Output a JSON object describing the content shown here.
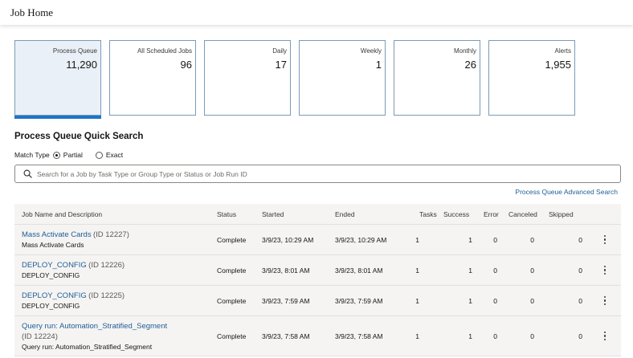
{
  "page": {
    "title": "Job Home"
  },
  "tiles": [
    {
      "label": "Process Queue",
      "value": "11,290",
      "selected": true
    },
    {
      "label": "All Scheduled Jobs",
      "value": "96",
      "selected": false
    },
    {
      "label": "Daily",
      "value": "17",
      "selected": false
    },
    {
      "label": "Weekly",
      "value": "1",
      "selected": false
    },
    {
      "label": "Monthly",
      "value": "26",
      "selected": false
    },
    {
      "label": "Alerts",
      "value": "1,955",
      "selected": false
    }
  ],
  "quick_search": {
    "title": "Process Queue Quick Search",
    "match_type_label": "Match Type",
    "options": [
      "Partial",
      "Exact"
    ],
    "selected_option": "Partial",
    "search_placeholder": "Search for a Job by Task Type or Group Type or Status or Job Run ID",
    "search_value": "",
    "advanced_link": "Process Queue Advanced Search"
  },
  "table": {
    "columns": [
      "Job Name and Description",
      "Status",
      "Started",
      "Ended",
      "Tasks",
      "Success",
      "Error",
      "Canceled",
      "Skipped"
    ],
    "rows": [
      {
        "name": "Mass Activate Cards",
        "id": "(ID 12227)",
        "desc": "Mass Activate Cards",
        "status": "Complete",
        "started": "3/9/23, 10:29 AM",
        "ended": "3/9/23, 10:29 AM",
        "tasks": "1",
        "success": "1",
        "error": "0",
        "canceled": "0",
        "skipped": "0"
      },
      {
        "name": "DEPLOY_CONFIG",
        "id": "(ID 12226)",
        "desc": "DEPLOY_CONFIG",
        "status": "Complete",
        "started": "3/9/23, 8:01 AM",
        "ended": "3/9/23, 8:01 AM",
        "tasks": "1",
        "success": "1",
        "error": "0",
        "canceled": "0",
        "skipped": "0"
      },
      {
        "name": "DEPLOY_CONFIG",
        "id": "(ID 12225)",
        "desc": "DEPLOY_CONFIG",
        "status": "Complete",
        "started": "3/9/23, 7:59 AM",
        "ended": "3/9/23, 7:59 AM",
        "tasks": "1",
        "success": "1",
        "error": "0",
        "canceled": "0",
        "skipped": "0"
      },
      {
        "name": "Query run: Automation_Stratified_Segment",
        "id": "(ID 12224)",
        "desc": "Query run: Automation_Stratified_Segment",
        "status": "Complete",
        "started": "3/9/23, 7:58 AM",
        "ended": "3/9/23, 7:58 AM",
        "tasks": "1",
        "success": "1",
        "error": "0",
        "canceled": "0",
        "skipped": "0"
      }
    ]
  },
  "icons": {
    "search": "search-icon",
    "row_menu": "more-vertical-icon"
  },
  "colors": {
    "accent": "#1f74c6",
    "link": "#1f5d99",
    "tile_border": "#7a9bb8",
    "row_bg": "#f5f4f2"
  }
}
